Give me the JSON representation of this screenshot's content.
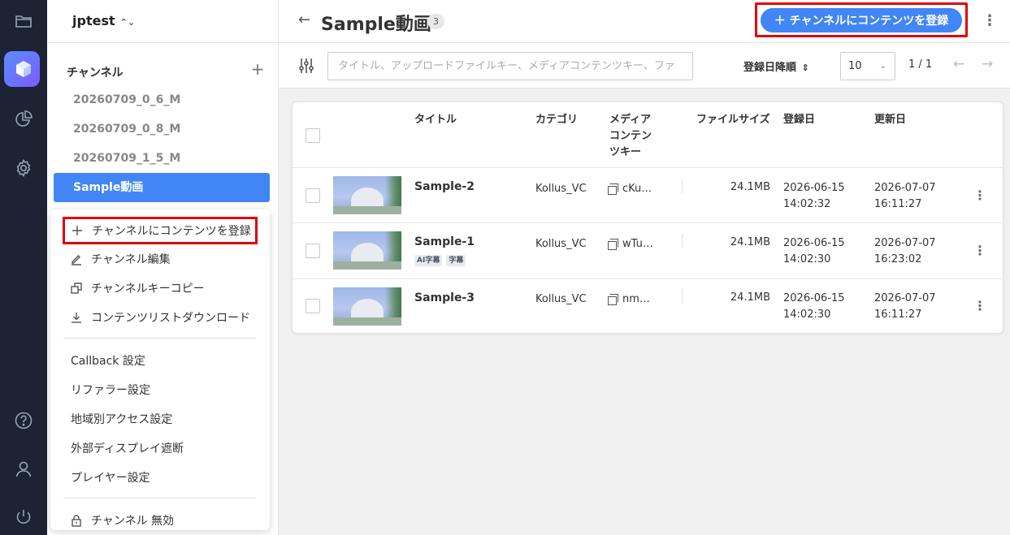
{
  "colors": {
    "accent": "#4286f5",
    "highlight": "#e10000",
    "rail": "#1c2333"
  },
  "rail": {
    "icons": [
      "folder-icon",
      "cube-icon",
      "pie-chart-icon",
      "gear-icon",
      "help-icon",
      "user-icon",
      "power-icon"
    ]
  },
  "sidebar": {
    "workspace": "jptest",
    "workspace_caret": "⌃⌄",
    "channel_label": "チャンネル",
    "add_symbol": "+",
    "channels": [
      {
        "label": "20260709_0_6_M"
      },
      {
        "label": "20260709_0_8_M"
      },
      {
        "label": "20260709_1_5_M"
      },
      {
        "label": "Sample動画"
      }
    ]
  },
  "menu": {
    "items": [
      {
        "label": "チャンネルにコンテンツを登録"
      },
      {
        "label": "チャンネル編集"
      },
      {
        "label": "チャンネルキーコピー"
      },
      {
        "label": "コンテンツリストダウンロード"
      },
      {
        "label": "Callback 設定"
      },
      {
        "label": "リファラー設定"
      },
      {
        "label": "地域別アクセス設定"
      },
      {
        "label": "外部ディスプレイ遮断"
      },
      {
        "label": "プレイヤー設定"
      },
      {
        "label": "チャンネル 無効"
      }
    ]
  },
  "header": {
    "back_arrow": "←",
    "title": "Sample動画",
    "count": "3",
    "primary_button": "＋ チャンネルにコンテンツを登録",
    "more": "⋮"
  },
  "filterbar": {
    "search_placeholder": "タイトル、アップロードファイルキー、メディアコンテンツキー、ファ",
    "sort_label": "登録日降順",
    "sort_caret": "⇕",
    "page_size": "10",
    "page_size_chevron": "⌄",
    "page_info": "1 / 1",
    "prev": "←",
    "next": "→"
  },
  "table": {
    "headers": {
      "title": "タイトル",
      "category": "カテゴリ",
      "media_key": "メディア\nコンテン\nツキー",
      "file_size": "ファイルサイズ",
      "created": "登録日",
      "updated": "更新日"
    },
    "rows": [
      {
        "title": "Sample-2",
        "tags": [],
        "category": "Kollus_VC",
        "media_key": "cKu…",
        "file_size": "24.1MB",
        "created_date": "2026-06-15",
        "created_time": "14:02:32",
        "updated_date": "2026-07-07",
        "updated_time": "16:11:27"
      },
      {
        "title": "Sample-1",
        "tags": [
          "AI字幕",
          "字幕"
        ],
        "category": "Kollus_VC",
        "media_key": "wTu…",
        "file_size": "24.1MB",
        "created_date": "2026-06-15",
        "created_time": "14:02:30",
        "updated_date": "2026-07-07",
        "updated_time": "16:23:02"
      },
      {
        "title": "Sample-3",
        "tags": [],
        "category": "Kollus_VC",
        "media_key": "nm…",
        "file_size": "24.1MB",
        "created_date": "2026-06-15",
        "created_time": "14:02:30",
        "updated_date": "2026-07-07",
        "updated_time": "16:11:27"
      }
    ],
    "row_more": "⋮"
  }
}
